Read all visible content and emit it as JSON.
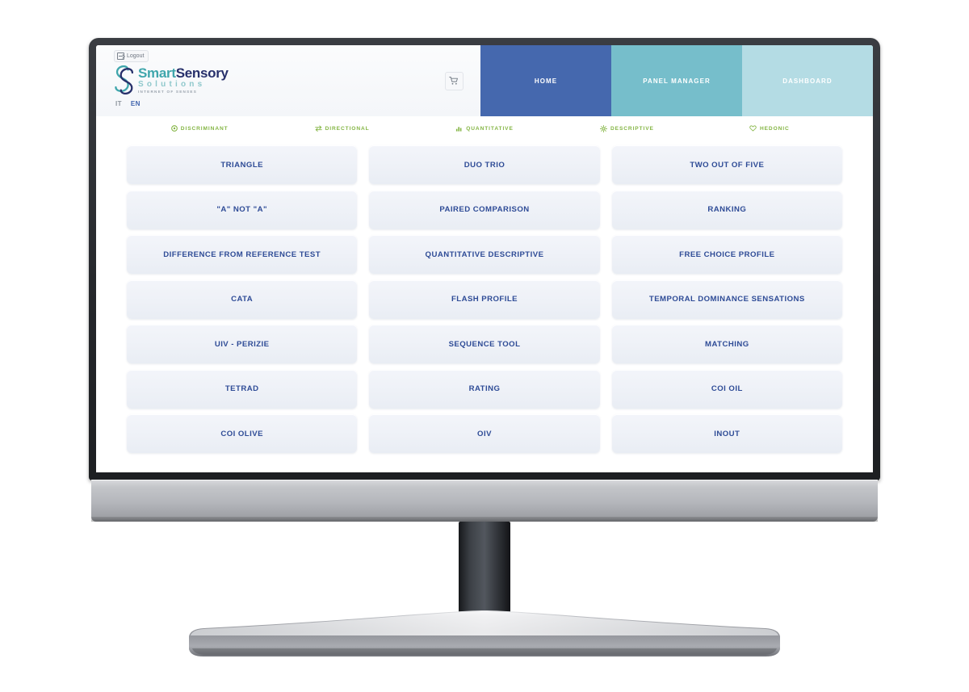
{
  "header": {
    "logout_label": "Logout",
    "logo": {
      "word1": "Smart",
      "word2": "Sensory",
      "subtitle": "Solutions",
      "tagline": "INTERNET OF SENSES"
    },
    "languages": [
      {
        "code": "IT",
        "active": false
      },
      {
        "code": "EN",
        "active": true
      }
    ],
    "cart_icon": "shopping-cart-icon",
    "nav": [
      {
        "label": "HOME",
        "color": "#4568ae"
      },
      {
        "label": "PANEL MANAGER",
        "color": "#76becb"
      },
      {
        "label": "DASHBOARD",
        "color": "#b4dce4"
      }
    ]
  },
  "categories": [
    {
      "label": "DISCRIMINANT",
      "icon": "target-icon"
    },
    {
      "label": "DIRECTIONAL",
      "icon": "exchange-arrows-icon"
    },
    {
      "label": "QUANTITATIVE",
      "icon": "bar-chart-icon"
    },
    {
      "label": "DESCRIPTIVE",
      "icon": "sun-icon"
    },
    {
      "label": "HEDONIC",
      "icon": "heart-icon"
    }
  ],
  "category_color": "#84b544",
  "cards": [
    "TRIANGLE",
    "DUO TRIO",
    "TWO OUT OF FIVE",
    "\"A\" NOT \"A\"",
    "PAIRED COMPARISON",
    "RANKING",
    "DIFFERENCE FROM REFERENCE TEST",
    "QUANTITATIVE DESCRIPTIVE",
    "FREE CHOICE PROFILE",
    "CATA",
    "FLASH PROFILE",
    "TEMPORAL DOMINANCE SENSATIONS",
    "UIV - PERIZIE",
    "SEQUENCE TOOL",
    "MATCHING",
    "TETRAD",
    "RATING",
    "COI OIL",
    "COI OLIVE",
    "OIV",
    "INOUT"
  ],
  "card_text_color": "#2e4b96"
}
